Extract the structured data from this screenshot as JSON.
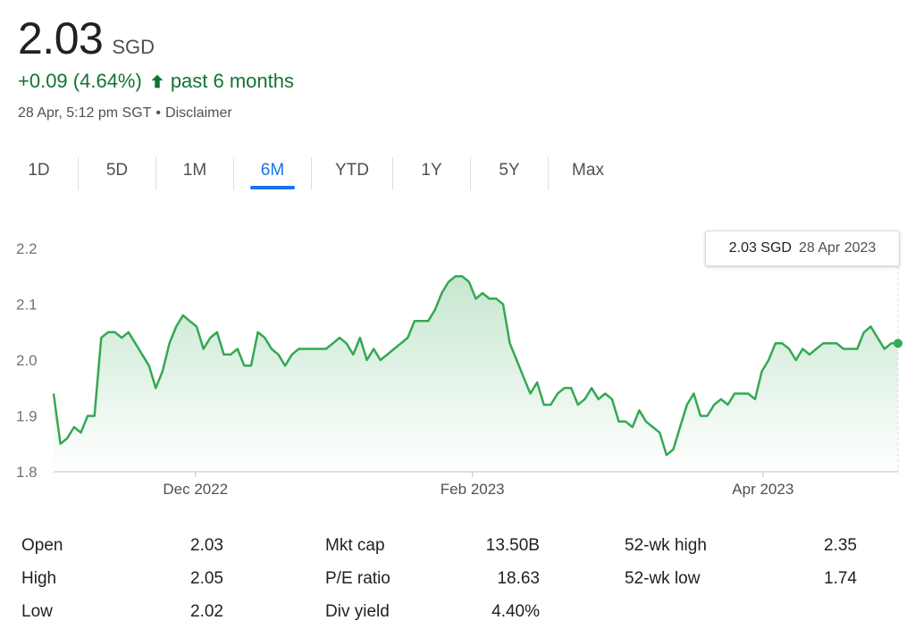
{
  "quote": {
    "price": "2.03",
    "currency": "SGD",
    "change": "+0.09 (4.64%)",
    "change_period": "past 6 months",
    "timestamp": "28 Apr, 5:12 pm SGT",
    "disclaimer": "Disclaimer",
    "up_color": "#137333"
  },
  "tabs": [
    {
      "label": "1D",
      "active": false
    },
    {
      "label": "5D",
      "active": false
    },
    {
      "label": "1M",
      "active": false
    },
    {
      "label": "6M",
      "active": true
    },
    {
      "label": "YTD",
      "active": false
    },
    {
      "label": "1Y",
      "active": false
    },
    {
      "label": "5Y",
      "active": false
    },
    {
      "label": "Max",
      "active": false
    }
  ],
  "tooltip": {
    "value": "2.03 SGD",
    "date": "28 Apr 2023"
  },
  "chart_data": {
    "type": "area",
    "y_ticks": [
      "2.2",
      "2.1",
      "2.0",
      "1.9",
      "1.8"
    ],
    "x_ticks": [
      "Dec 2022",
      "Feb 2023",
      "Apr 2023"
    ],
    "ylim": [
      1.8,
      2.2
    ],
    "line_color": "#34a853",
    "fill": "gradient green to white",
    "grid": false,
    "series": [
      {
        "values": [
          1.94,
          1.85,
          1.86,
          1.88,
          1.87,
          1.9,
          1.9,
          2.04,
          2.05,
          2.05,
          2.04,
          2.05,
          2.03,
          2.01,
          1.99,
          1.95,
          1.98,
          2.03,
          2.06,
          2.08,
          2.07,
          2.06,
          2.02,
          2.04,
          2.05,
          2.01,
          2.01,
          2.02,
          1.99,
          1.99,
          2.05,
          2.04,
          2.02,
          2.01,
          1.99,
          2.01,
          2.02,
          2.02,
          2.02,
          2.02,
          2.02,
          2.03,
          2.04,
          2.03,
          2.01,
          2.04,
          2.0,
          2.02,
          2.0,
          2.01,
          2.02,
          2.03,
          2.04,
          2.07,
          2.07,
          2.07,
          2.09,
          2.12,
          2.14,
          2.15,
          2.15,
          2.14,
          2.11,
          2.12,
          2.11,
          2.11,
          2.1,
          2.03,
          2.0,
          1.97,
          1.94,
          1.96,
          1.92,
          1.92,
          1.94,
          1.95,
          1.95,
          1.92,
          1.93,
          1.95,
          1.93,
          1.94,
          1.93,
          1.89,
          1.89,
          1.88,
          1.91,
          1.89,
          1.88,
          1.87,
          1.83,
          1.84,
          1.88,
          1.92,
          1.94,
          1.9,
          1.9,
          1.92,
          1.93,
          1.92,
          1.94,
          1.94,
          1.94,
          1.93,
          1.98,
          2.0,
          2.03,
          2.03,
          2.02,
          2.0,
          2.02,
          2.01,
          2.02,
          2.03,
          2.03,
          2.03,
          2.02,
          2.02,
          2.02,
          2.05,
          2.06,
          2.04,
          2.02,
          2.03,
          2.03
        ]
      }
    ]
  },
  "stats": [
    [
      {
        "label": "Open",
        "value": "2.03"
      },
      {
        "label": "Mkt cap",
        "value": "13.50B"
      },
      {
        "label": "52-wk high",
        "value": "2.35"
      }
    ],
    [
      {
        "label": "High",
        "value": "2.05"
      },
      {
        "label": "P/E ratio",
        "value": "18.63"
      },
      {
        "label": "52-wk low",
        "value": "1.74"
      }
    ],
    [
      {
        "label": "Low",
        "value": "2.02"
      },
      {
        "label": "Div yield",
        "value": "4.40%"
      },
      {
        "label": "",
        "value": ""
      }
    ]
  ]
}
